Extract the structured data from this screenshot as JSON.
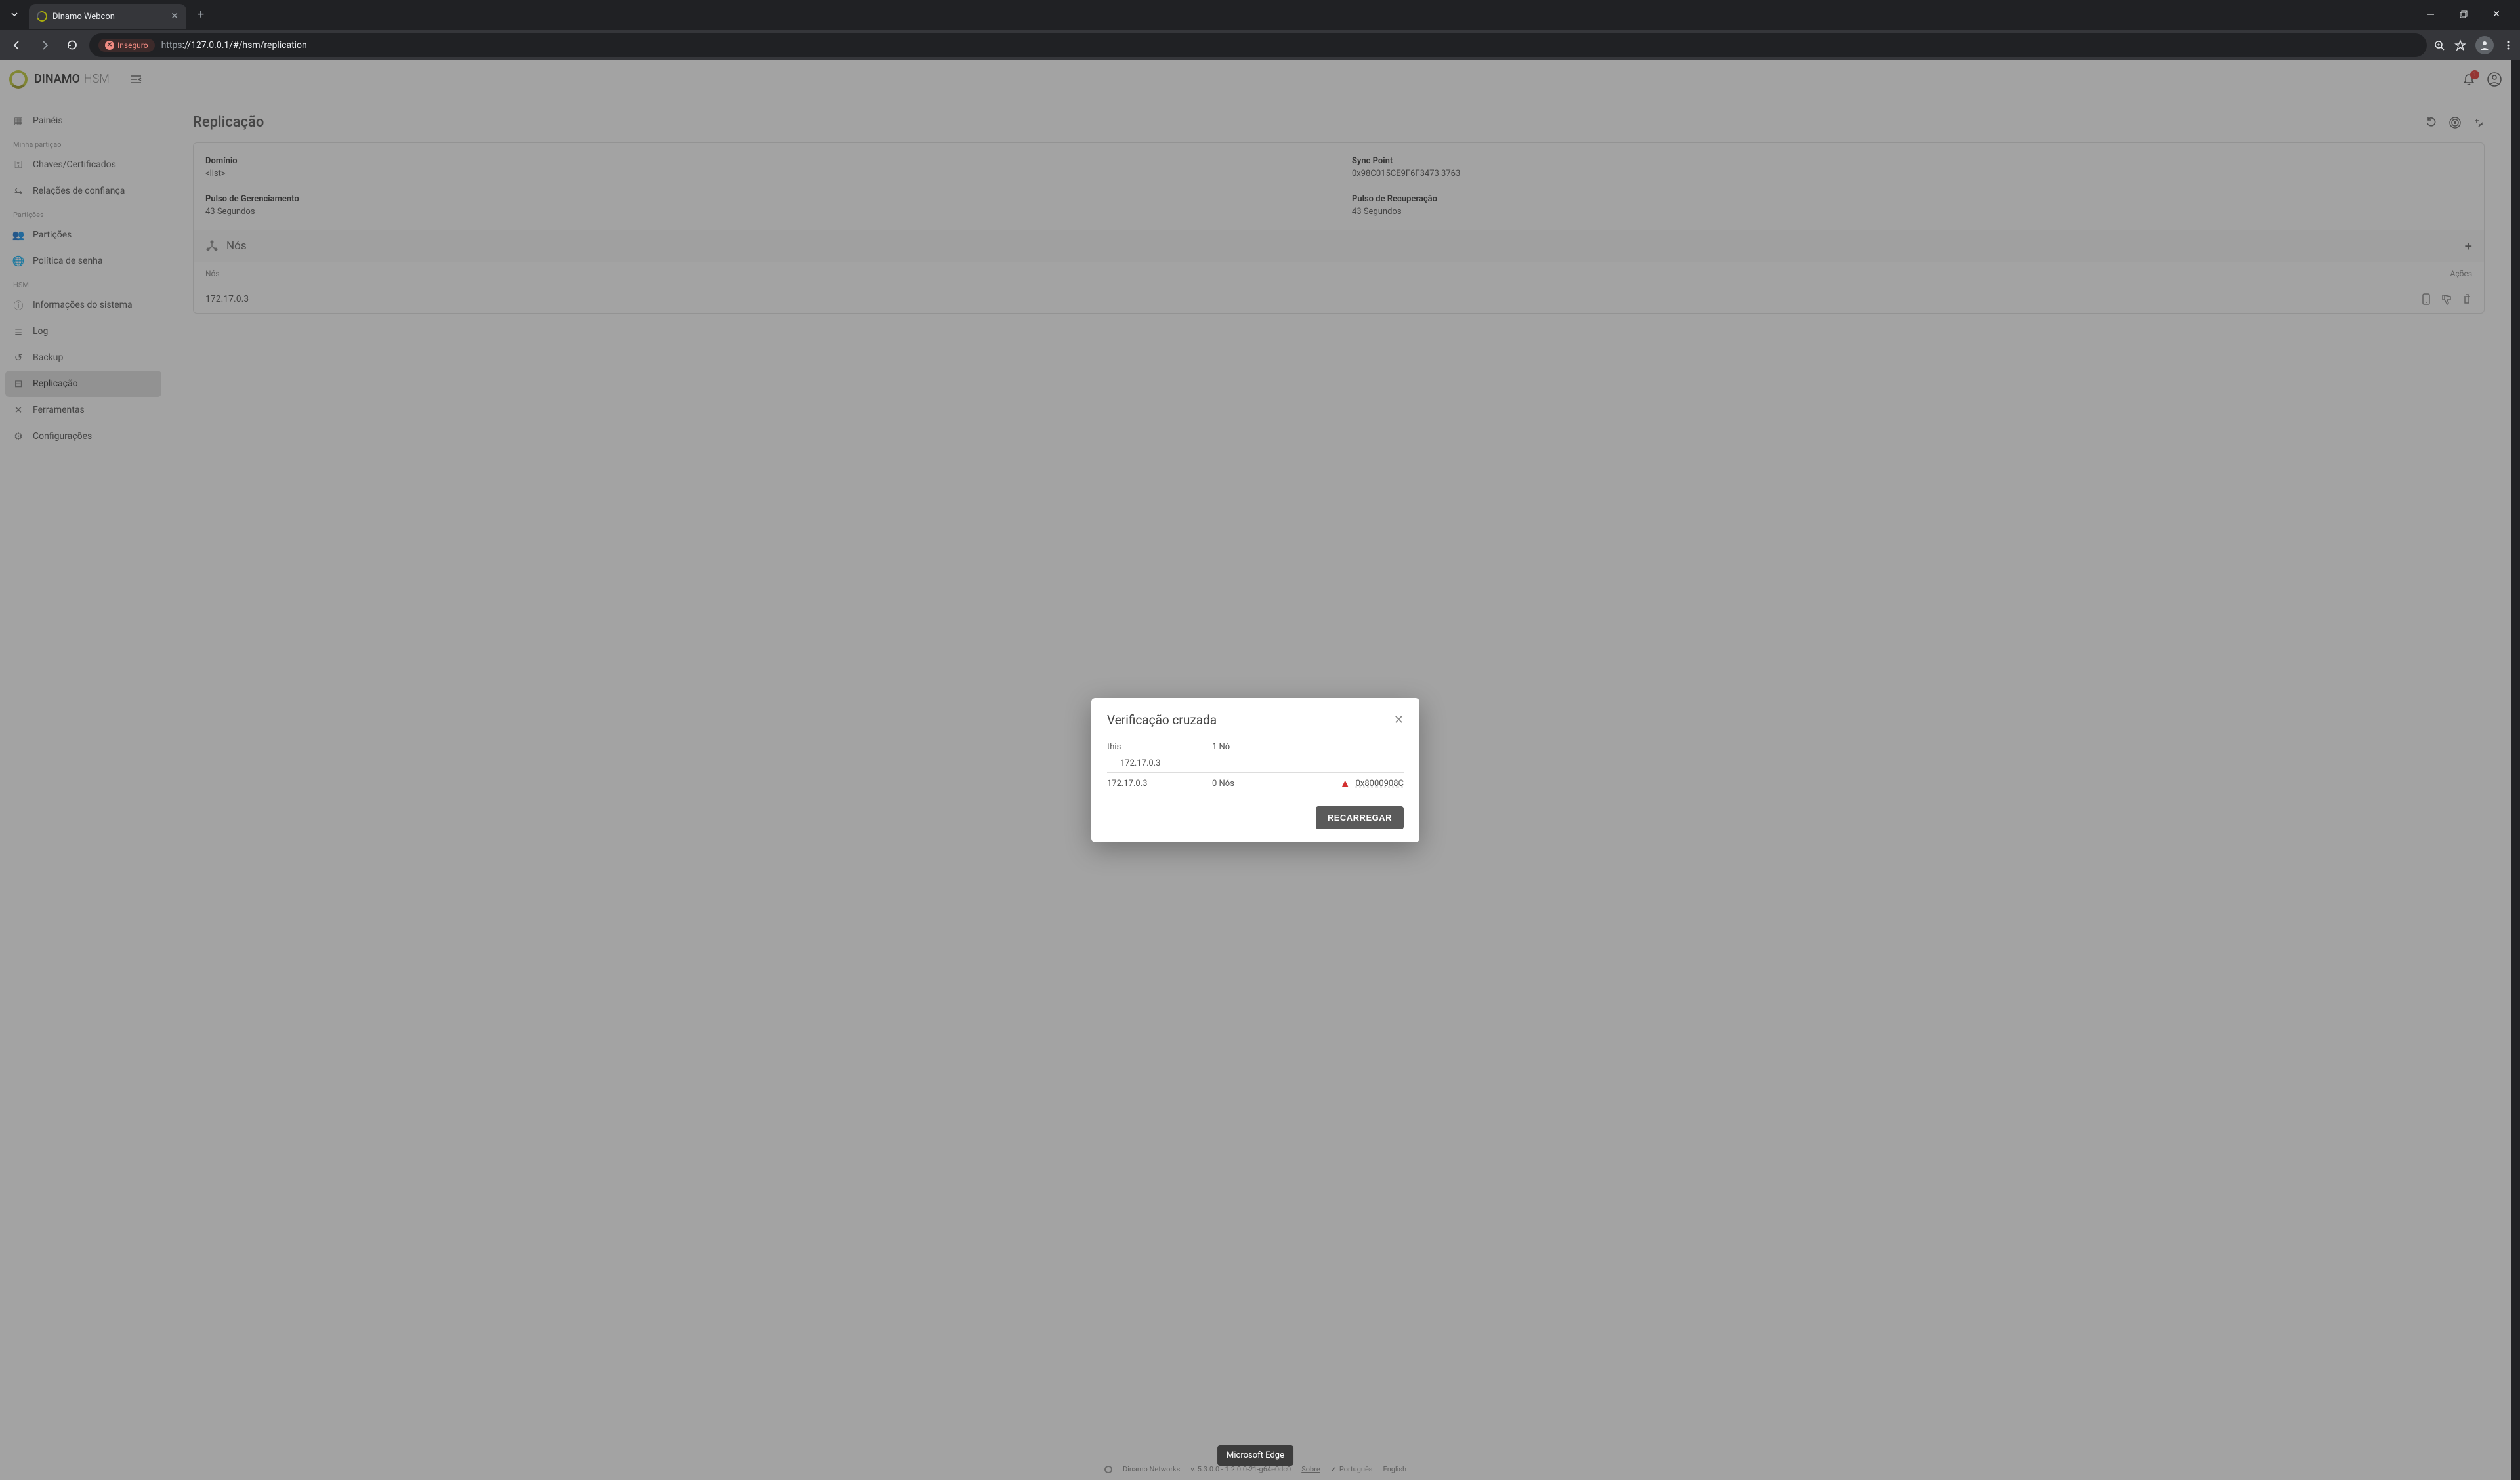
{
  "browser": {
    "tab_title": "Dinamo Webcon",
    "insecure_label": "Inseguro",
    "url_proto": "https",
    "url_rest": "://127.0.0.1/#/hsm/replication"
  },
  "header": {
    "brand": "DINAMO",
    "brand_sub": "HSM",
    "notif_count": "1"
  },
  "sidebar": {
    "items": {
      "paineis": "Painéis",
      "section_my": "Minha partição",
      "chaves": "Chaves/Certificados",
      "relacoes": "Relações de confiança",
      "section_part": "Partições",
      "particoes": "Partições",
      "politica": "Política de senha",
      "section_hsm": "HSM",
      "info": "Informações do sistema",
      "log": "Log",
      "backup": "Backup",
      "replicacao": "Replicação",
      "ferramentas": "Ferramentas",
      "config": "Configurações"
    }
  },
  "page": {
    "title": "Replicação",
    "domain_label": "Domínio",
    "domain_value": "<list>",
    "syncpoint_label": "Sync Point",
    "syncpoint_value": "0x98C015CE9F6F3473 3763",
    "pulse_mgmt_label": "Pulso de Gerenciamento",
    "pulse_mgmt_value": "43 Segundos",
    "pulse_rec_label": "Pulso de Recuperação",
    "pulse_rec_value": "43 Segundos",
    "nodes_section": "Nós",
    "th_nodes": "Nós",
    "th_actions": "Ações",
    "row_ip": "172.17.0.3"
  },
  "modal": {
    "title": "Verificação cruzada",
    "row1_host": "this",
    "row1_count": "1 Nó",
    "row1_sub": "172.17.0.3",
    "row2_host": "172.17.0.3",
    "row2_count": "0 Nós",
    "row2_err": "0x8000908C",
    "reload": "RECARREGAR"
  },
  "footer": {
    "company": "Dinamo Networks",
    "version": "v. 5.3.0.0 - 1.2.0.0-21-g64e0dc0",
    "about": "Sobre",
    "lang_pt": "Português",
    "lang_en": "English"
  },
  "tooltip": "Microsoft Edge"
}
